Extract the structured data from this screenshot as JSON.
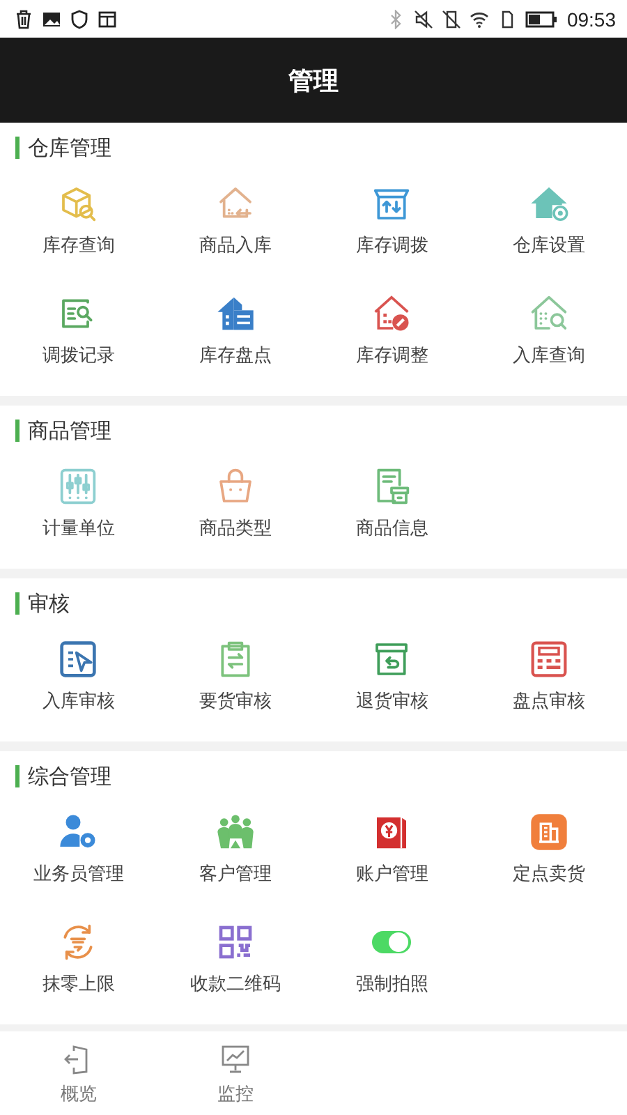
{
  "status_bar": {
    "time": "09:53"
  },
  "header": {
    "title": "管理"
  },
  "sections": [
    {
      "title": "仓库管理",
      "items": [
        {
          "label": "库存查询",
          "kind": "icon"
        },
        {
          "label": "商品入库",
          "kind": "icon"
        },
        {
          "label": "库存调拨",
          "kind": "icon"
        },
        {
          "label": "仓库设置",
          "kind": "icon"
        },
        {
          "label": "调拨记录",
          "kind": "icon"
        },
        {
          "label": "库存盘点",
          "kind": "icon"
        },
        {
          "label": "库存调整",
          "kind": "icon"
        },
        {
          "label": "入库查询",
          "kind": "icon"
        }
      ]
    },
    {
      "title": "商品管理",
      "items": [
        {
          "label": "计量单位",
          "kind": "icon"
        },
        {
          "label": "商品类型",
          "kind": "icon"
        },
        {
          "label": "商品信息",
          "kind": "icon"
        }
      ]
    },
    {
      "title": "审核",
      "items": [
        {
          "label": "入库审核",
          "kind": "icon"
        },
        {
          "label": "要货审核",
          "kind": "icon"
        },
        {
          "label": "退货审核",
          "kind": "icon"
        },
        {
          "label": "盘点审核",
          "kind": "icon"
        }
      ]
    },
    {
      "title": "综合管理",
      "items": [
        {
          "label": "业务员管理",
          "kind": "icon"
        },
        {
          "label": "客户管理",
          "kind": "icon"
        },
        {
          "label": "账户管理",
          "kind": "icon"
        },
        {
          "label": "定点卖货",
          "kind": "icon"
        },
        {
          "label": "抹零上限",
          "kind": "icon"
        },
        {
          "label": "收款二维码",
          "kind": "icon"
        },
        {
          "label": "强制拍照",
          "kind": "toggle",
          "on": true
        }
      ]
    }
  ],
  "bottom_nav": [
    {
      "label": "概览"
    },
    {
      "label": "监控"
    }
  ]
}
